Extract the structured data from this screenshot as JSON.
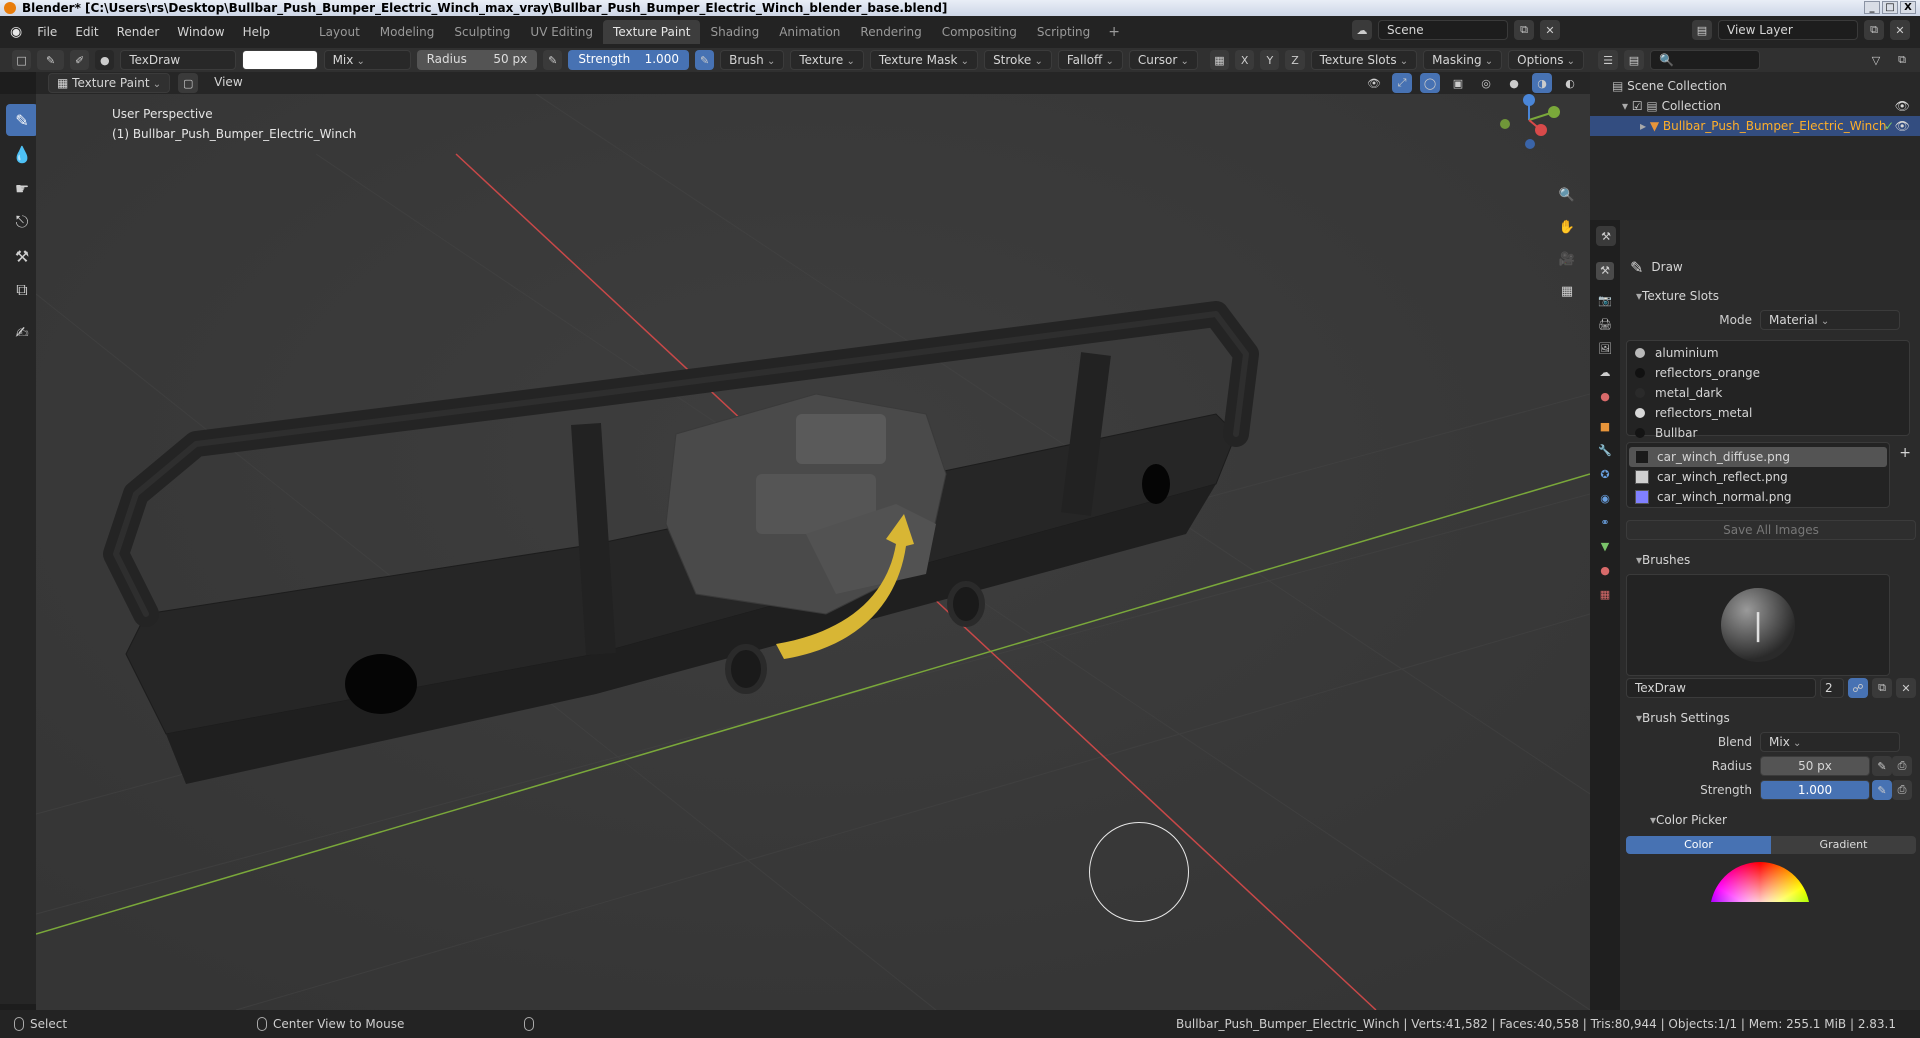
{
  "title_bar": {
    "text": "Blender* [C:\\Users\\rs\\Desktop\\Bullbar_Push_Bumper_Electric_Winch_max_vray\\Bullbar_Push_Bumper_Electric_Winch_blender_base.blend]",
    "buttons": [
      "_",
      "□",
      "X"
    ]
  },
  "menu": [
    "File",
    "Edit",
    "Render",
    "Window",
    "Help"
  ],
  "workspaces": [
    "Layout",
    "Modeling",
    "Sculpting",
    "UV Editing",
    "Texture Paint",
    "Shading",
    "Animation",
    "Rendering",
    "Compositing",
    "Scripting"
  ],
  "active_workspace": "Texture Paint",
  "scene_field": "Scene",
  "view_layer_field": "View Layer",
  "tool_header": {
    "brush_name": "TexDraw",
    "blend": "Mix",
    "radius_label": "Radius",
    "radius_value": "50 px",
    "strength_label": "Strength",
    "strength_value": "1.000",
    "menus": [
      "Brush",
      "Texture",
      "Texture Mask",
      "Stroke",
      "Falloff",
      "Cursor"
    ],
    "axes": [
      "X",
      "Y",
      "Z"
    ],
    "right_menus": [
      "Texture Slots",
      "Masking",
      "Options"
    ]
  },
  "sub_header": {
    "mode": "Texture Paint",
    "view": "View"
  },
  "viewport": {
    "perspective": "User Perspective",
    "object": "(1) Bullbar_Push_Bumper_Electric_Winch"
  },
  "outliner": {
    "root": "Scene Collection",
    "collection": "Collection",
    "object": "Bullbar_Push_Bumper_Electric_Winch"
  },
  "properties": {
    "tool_name": "Draw",
    "texture_slots_title": "Texture Slots",
    "mode_label": "Mode",
    "mode_value": "Material",
    "materials": [
      {
        "name": "aluminium",
        "color": "#b9b9b9"
      },
      {
        "name": "reflectors_orange",
        "color": "#111111"
      },
      {
        "name": "metal_dark",
        "color": "#2a2a2a"
      },
      {
        "name": "reflectors_metal",
        "color": "#d8d8d8"
      },
      {
        "name": "Bullbar",
        "color": "#141414"
      }
    ],
    "images": [
      {
        "name": "car_winch_diffuse.png",
        "color": "#1a1a1a"
      },
      {
        "name": "car_winch_reflect.png",
        "color": "#d0d0d0"
      },
      {
        "name": "car_winch_normal.png",
        "color": "#8080ff"
      }
    ],
    "save_all": "Save All Images",
    "brushes_title": "Brushes",
    "brush_name": "TexDraw",
    "brush_users": "2",
    "brush_settings_title": "Brush Settings",
    "blend_label": "Blend",
    "blend_value": "Mix",
    "radius_label": "Radius",
    "radius_value": "50 px",
    "strength_label": "Strength",
    "strength_value": "1.000",
    "color_picker_title": "Color Picker",
    "color_tab": "Color",
    "gradient_tab": "Gradient"
  },
  "status": {
    "select": "Select",
    "center": "Center View to Mouse",
    "stats": "Bullbar_Push_Bumper_Electric_Winch | Verts:41,582 | Faces:40,558 | Tris:80,944 | Objects:1/1 | Mem: 255.1 MiB | 2.83.1"
  },
  "colors": {
    "accent": "#4772b3",
    "viewport_bg": "#393939",
    "x_axis": "#c84848",
    "y_axis": "#7aa83a",
    "arrow": "#d8b634"
  }
}
